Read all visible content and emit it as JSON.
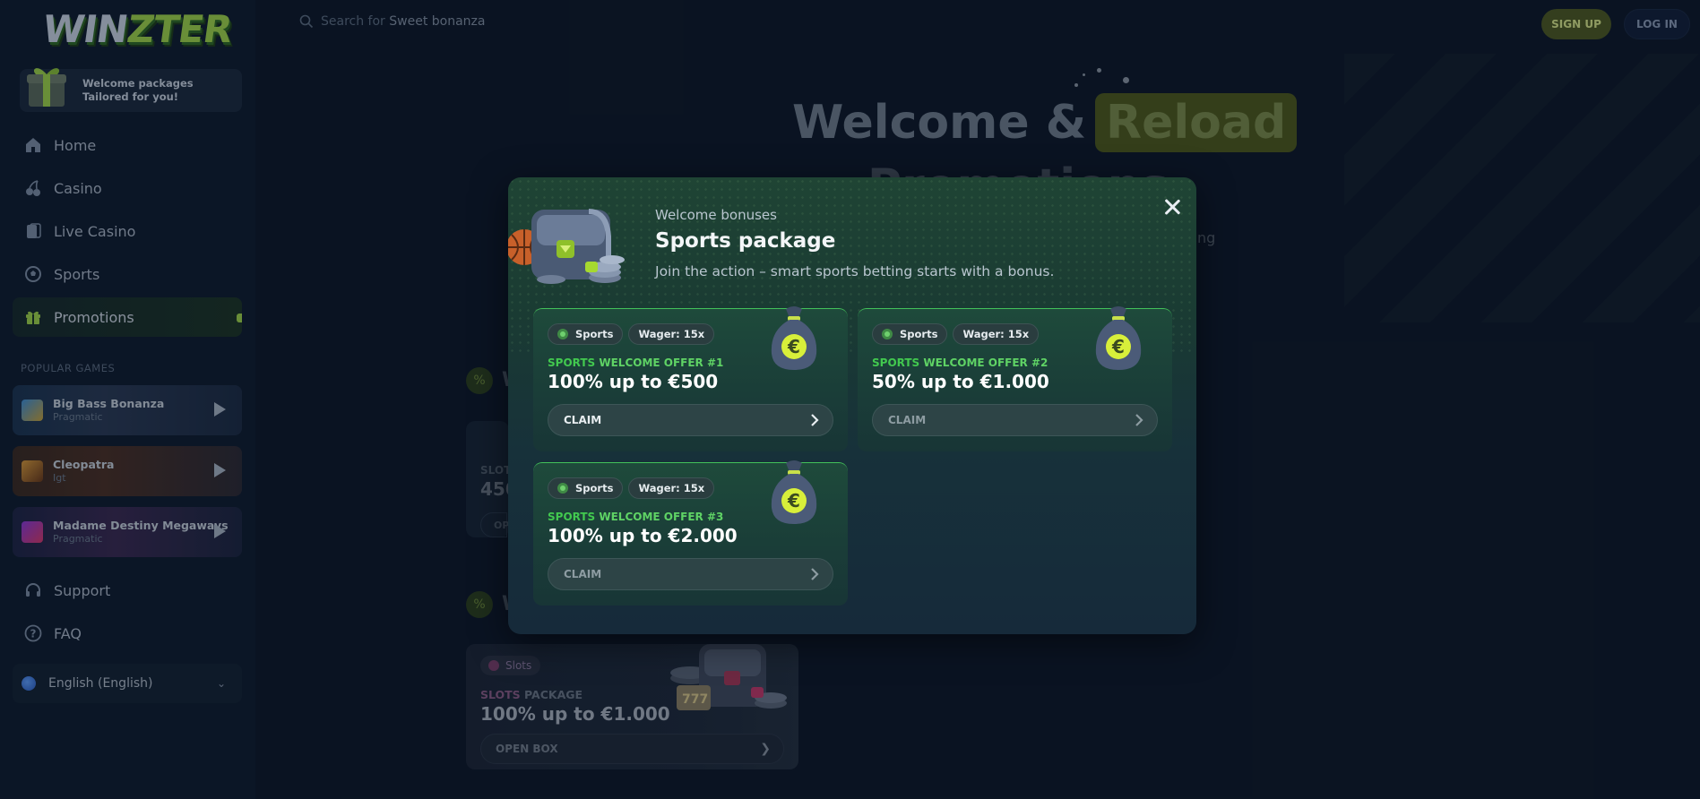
{
  "brand": {
    "logo_text_1": "WIN",
    "logo_text_2": "ZTER"
  },
  "promo_banner": {
    "line1": "Welcome packages",
    "line2": "Tailored for you!"
  },
  "nav": [
    {
      "label": "Home",
      "icon": "home-icon"
    },
    {
      "label": "Casino",
      "icon": "cherry-icon"
    },
    {
      "label": "Live Casino",
      "icon": "cards-icon"
    },
    {
      "label": "Sports",
      "icon": "soccer-ball-icon"
    },
    {
      "label": "Promotions",
      "icon": "gift-icon",
      "active": true
    }
  ],
  "popular_games": {
    "title": "POPULAR GAMES",
    "items": [
      {
        "name": "Big Bass Bonanza",
        "provider": "Pragmatic"
      },
      {
        "name": "Cleopatra",
        "provider": "Igt"
      },
      {
        "name": "Madame Destiny Megaways",
        "provider": "Pragmatic"
      }
    ]
  },
  "footer_nav": [
    {
      "label": "Support",
      "icon": "headset-icon"
    },
    {
      "label": "FAQ",
      "icon": "question-icon"
    }
  ],
  "language": {
    "label": "English (English)"
  },
  "search": {
    "prefix": "Search for",
    "suggestion": "Sweet bonanza"
  },
  "header": {
    "signup_label": "SIGN UP",
    "login_label": "LOG IN"
  },
  "background_page": {
    "hero_part1": "Welcome &",
    "hero_highlight": "Reload",
    "hero_line2": "Promotions",
    "hero_side": "ng",
    "section_letter": "W",
    "peek_card": {
      "title": "SLOT",
      "value": "450",
      "button": "OP"
    },
    "slots_card": {
      "tag": "Slots",
      "title_prefix": "SLOTS",
      "title_suffix": "PACKAGE",
      "value": "100% up to €1.000",
      "button": "OPEN BOX"
    }
  },
  "modal": {
    "subtitle": "Welcome bonuses",
    "title": "Sports package",
    "description": "Join the action – smart sports betting starts with a bonus.",
    "offers": [
      {
        "chip_sport": "Sports",
        "chip_wager": "Wager: 15x",
        "title_prefix": "SPORTS",
        "title_suffix": "WELCOME OFFER #1",
        "value": "100% up to €500",
        "claim": "CLAIM"
      },
      {
        "chip_sport": "Sports",
        "chip_wager": "Wager: 15x",
        "title_prefix": "SPORTS",
        "title_suffix": "WELCOME OFFER #2",
        "value": "50% up to €1.000",
        "claim": "CLAIM"
      },
      {
        "chip_sport": "Sports",
        "chip_wager": "Wager: 15x",
        "title_prefix": "SPORTS",
        "title_suffix": "WELCOME OFFER #3",
        "value": "100% up to €2.000",
        "claim": "CLAIM"
      }
    ]
  },
  "colors": {
    "accent_green": "#42c94f",
    "brand_lime": "#9fd44a",
    "background": "#0d1828"
  }
}
